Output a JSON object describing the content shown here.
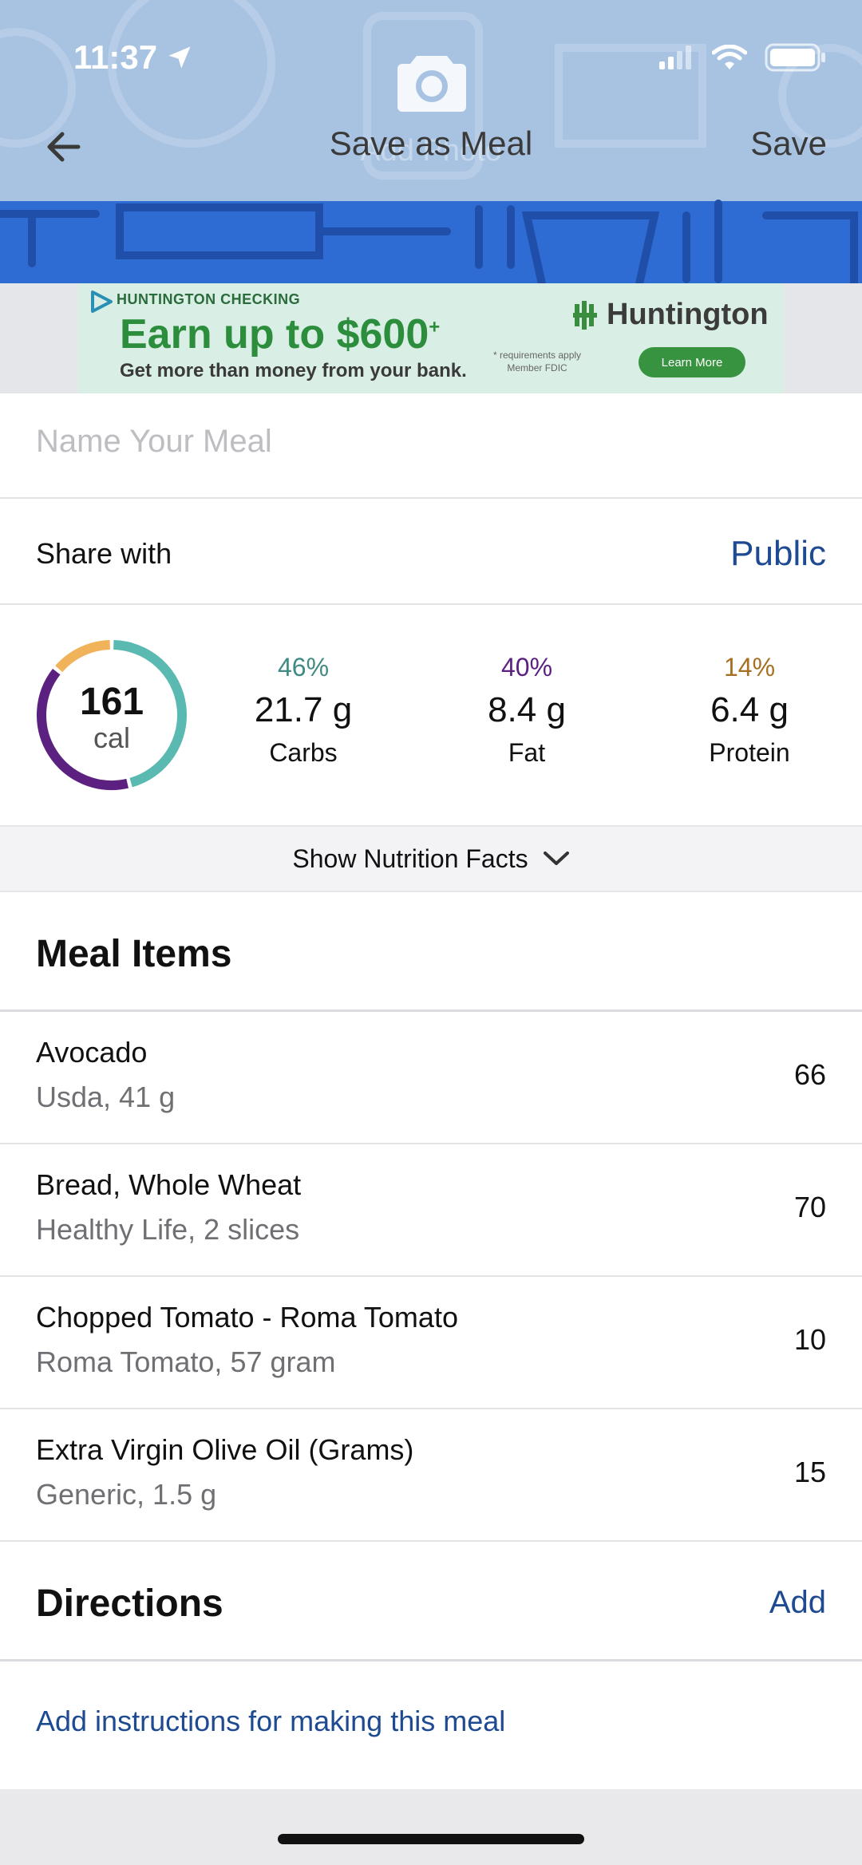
{
  "status": {
    "time": "11:37"
  },
  "nav": {
    "title": "Save as Meal",
    "save_label": "Save",
    "add_photo": "Add Photo"
  },
  "ad": {
    "headline": "HUNTINGTON CHECKING",
    "offer": "Earn up to $600",
    "offer_mark": "+",
    "tagline": "Get more than money from your bank.",
    "brand": "Huntington",
    "fine_print_1": "* requirements apply",
    "fine_print_2": "Member FDIC",
    "cta": "Learn More"
  },
  "meal_name": {
    "value": "",
    "placeholder": "Name Your Meal"
  },
  "share": {
    "label": "Share with",
    "value": "Public"
  },
  "calories": {
    "value": "161",
    "unit": "cal"
  },
  "macros": [
    {
      "percent": "46%",
      "amount": "21.7 g",
      "label": "Carbs",
      "color": "#3f8b83",
      "fraction": 0.46
    },
    {
      "percent": "40%",
      "amount": "8.4 g",
      "label": "Fat",
      "color": "#5c2180",
      "fraction": 0.4
    },
    {
      "percent": "14%",
      "amount": "6.4 g",
      "label": "Protein",
      "color": "#a66f22",
      "fraction": 0.14
    }
  ],
  "ring_colors": {
    "carbs": "#5ab9b1",
    "fat": "#5c2180",
    "protein": "#f0b35a"
  },
  "nutrition_toggle": "Show Nutrition Facts",
  "meal_items": {
    "title": "Meal Items",
    "items": [
      {
        "name": "Avocado",
        "detail": "Usda, 41 g",
        "calories": "66"
      },
      {
        "name": "Bread, Whole Wheat",
        "detail": "Healthy Life, 2 slices",
        "calories": "70"
      },
      {
        "name": "Chopped Tomato - Roma Tomato",
        "detail": "Roma Tomato, 57 gram",
        "calories": "10"
      },
      {
        "name": "Extra Virgin Olive Oil (Grams)",
        "detail": "Generic, 1.5 g",
        "calories": "15"
      }
    ]
  },
  "directions": {
    "title": "Directions",
    "add_label": "Add",
    "placeholder_text": "Add instructions for making this meal"
  },
  "accent_color": "#1e4a92",
  "header_color": "#2e6bd2"
}
